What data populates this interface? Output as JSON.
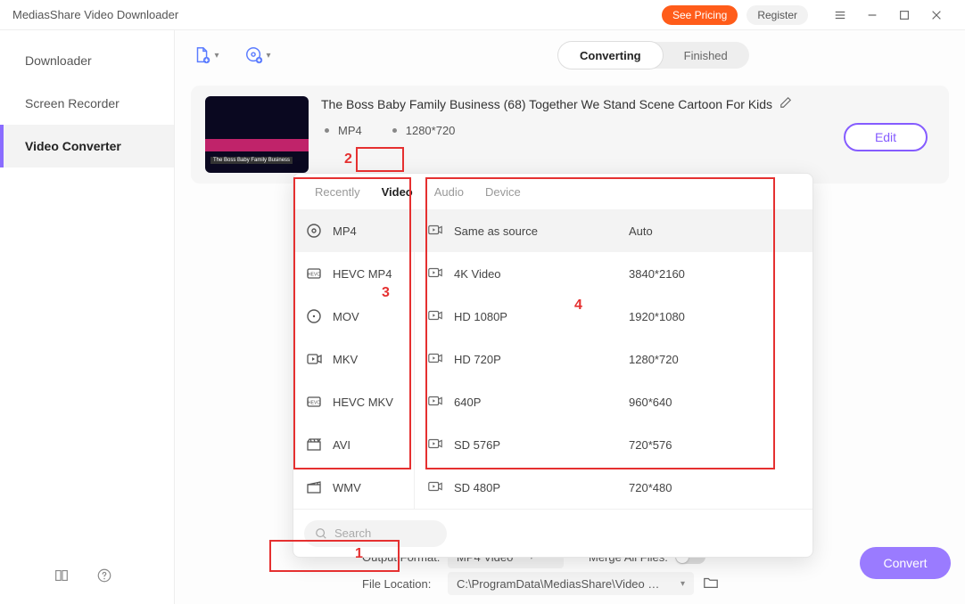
{
  "app": {
    "title": "MediasShare Video Downloader"
  },
  "header": {
    "see_pricing": "See Pricing",
    "register": "Register"
  },
  "sidebar": {
    "items": [
      {
        "label": "Downloader"
      },
      {
        "label": "Screen Recorder"
      },
      {
        "label": "Video Converter"
      }
    ]
  },
  "tabs": {
    "converting": "Converting",
    "finished": "Finished"
  },
  "item": {
    "title": "The Boss Baby Family Business (68)  Together We Stand Scene  Cartoon For Kids",
    "format": "MP4",
    "resolution": "1280*720",
    "edit": "Edit"
  },
  "popup": {
    "tabs": {
      "recently": "Recently",
      "video": "Video",
      "audio": "Audio",
      "device": "Device"
    },
    "formats": [
      {
        "label": "MP4"
      },
      {
        "label": "HEVC MP4"
      },
      {
        "label": "MOV"
      },
      {
        "label": "MKV"
      },
      {
        "label": "HEVC MKV"
      },
      {
        "label": "AVI"
      },
      {
        "label": "WMV"
      }
    ],
    "resolutions": [
      {
        "name": "Same as source",
        "res": "Auto"
      },
      {
        "name": "4K Video",
        "res": "3840*2160"
      },
      {
        "name": "HD 1080P",
        "res": "1920*1080"
      },
      {
        "name": "HD 720P",
        "res": "1280*720"
      },
      {
        "name": "640P",
        "res": "960*640"
      },
      {
        "name": "SD 576P",
        "res": "720*576"
      },
      {
        "name": "SD 480P",
        "res": "720*480"
      }
    ],
    "search_placeholder": "Search"
  },
  "bottom": {
    "output_format_label": "Output Format:",
    "output_format_value": "MP4 Video",
    "merge_label": "Merge All Files:",
    "file_location_label": "File Location:",
    "file_location_value": "C:\\ProgramData\\MediasShare\\Video Downloa",
    "convert": "Convert"
  },
  "annotations": {
    "1": "1",
    "2": "2",
    "3": "3",
    "4": "4"
  }
}
